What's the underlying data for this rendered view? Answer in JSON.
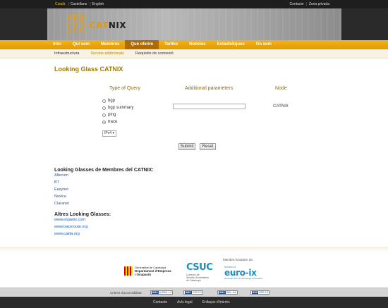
{
  "topbar": {
    "languages": [
      "Català",
      "Castellano",
      "English"
    ],
    "utilities": [
      "Contacte",
      "Zona privada"
    ]
  },
  "logo": {
    "prefix": "CAT",
    "suffix": "NIX"
  },
  "nav": {
    "items": [
      "Inici",
      "Qui som",
      "Membres",
      "Què oferim",
      "Tarifes",
      "Notícies",
      "Estadístiques",
      "On som"
    ],
    "active": "Què oferim"
  },
  "subnav": {
    "items": [
      "Infraestructura",
      "Serveis addicionals",
      "Requisits de connexió"
    ],
    "active": "Serveis addicionals"
  },
  "page": {
    "title": "Looking Glass CATNIX"
  },
  "form": {
    "col_query": "Type of Query",
    "col_params": "Additional parameters",
    "col_node": "Node",
    "queries": [
      "bgp",
      "bgp summary",
      "ping",
      "trace"
    ],
    "selected_query": "trace",
    "params_value": "",
    "node": "CATNIX",
    "ip_version": "IPv4",
    "submit_label": "Submit",
    "reset_label": "Reset"
  },
  "members": {
    "title": "Looking Glasses de Membres del CATNIX:",
    "links": [
      "Altecom",
      "BT",
      "Easynet",
      "Nexica",
      "Claranet"
    ]
  },
  "others": {
    "title": "Altres Looking Glasses:",
    "links": [
      "www.espanix.com",
      "www.traceroute.org",
      "www.caida.org"
    ]
  },
  "sponsors": {
    "generalitat": [
      "Generalitat de Catalunya",
      "Departament d'Empresa",
      "i Ocupació"
    ],
    "csuc_mark": "CSUC",
    "csuc_sub": [
      "Consorci de",
      "Serveis Universitaris",
      "de Catalunya"
    ],
    "founder_label": "Membre fundador de:",
    "euroix_small": "founder of",
    "euroix_mark": "euro-ix",
    "euroix_tag": "European Internet Exchange Association"
  },
  "accessibility": {
    "label": "Criteris d'accessibilitat:",
    "badges": [
      {
        "w": "W3C",
        "t": "XHTML 1.0"
      },
      {
        "w": "W3C",
        "t": "CSS 2.0"
      },
      {
        "w": "W3C",
        "t": "WAI - AA"
      },
      {
        "w": "RSS",
        "t": "RSS 2.0"
      }
    ]
  },
  "footer": {
    "links": [
      "Contacte",
      "Avís legal",
      "Enllaços d'interès"
    ]
  },
  "colors": {
    "accent": "#e39a00",
    "link": "#1a5aa6",
    "title": "#9a7a10"
  }
}
